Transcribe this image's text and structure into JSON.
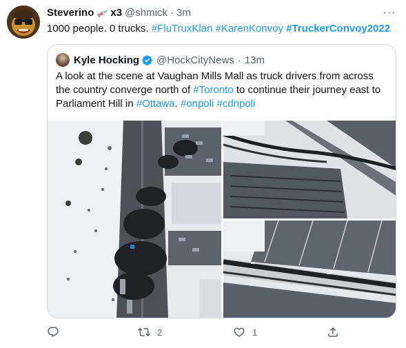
{
  "tweet": {
    "author": {
      "display_name": "Steverino",
      "name_suffix": "x3",
      "handle": "@shmick",
      "dot": "·",
      "time": "3m"
    },
    "text": {
      "plain": "1000 people. 0 trucks. ",
      "tag1": "#FluTruxKlan",
      "tag2": "#KarenKonvoy",
      "tag3": "#TruckerConvoy2022"
    },
    "more_label": "···"
  },
  "quote": {
    "author": {
      "display_name": "Kyle Hocking",
      "handle": "@HockCityNews",
      "dot": "·",
      "time": "13m"
    },
    "text": {
      "part1": "A look at the scene at Vaughan Mills Mall as truck drivers from across the country converge north of ",
      "tag1": "#Toronto",
      "part2": " to continue their journey east to Parliament Hill in ",
      "tag2": "#Ottawa",
      "part3": ". ",
      "tag3": "#onpoli",
      "part4": " ",
      "tag4": "#cdnpoli"
    }
  },
  "actions": {
    "reply_count": "",
    "retweet_count": "2",
    "like_count": "1"
  },
  "icons": {
    "reply": "reply-icon",
    "retweet": "retweet-icon",
    "like": "like-icon",
    "share": "share-icon",
    "verified": "verified-badge-icon",
    "syringe": "syringe-emoji-icon"
  },
  "colors": {
    "link": "#1d9bf0",
    "secondary_text": "#536471",
    "border": "#cfd9de",
    "verified": "#1d9bf0"
  }
}
